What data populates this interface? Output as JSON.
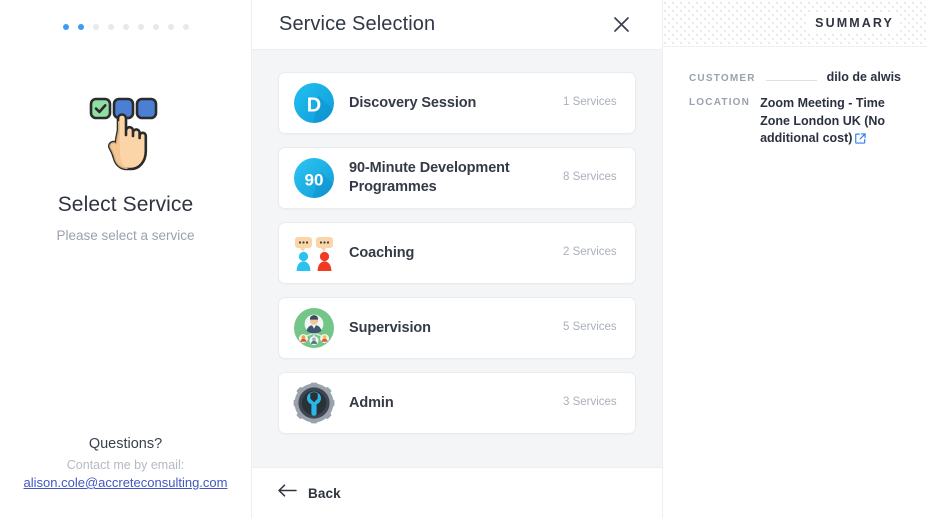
{
  "left": {
    "steps": {
      "total": 9,
      "active": 2
    },
    "hero_icon": "select-checkbox-hand-icon",
    "title": "Select Service",
    "subtitle": "Please select a service",
    "footer": {
      "questions": "Questions?",
      "contact_prompt": "Contact me by email:",
      "email": "alison.cole@accreteconsulting.com"
    }
  },
  "middle": {
    "header": {
      "title": "Service Selection",
      "close_icon": "close-icon"
    },
    "services": [
      {
        "icon": "letter-d-circle-icon",
        "name": "Discovery Session",
        "count": "1 Services"
      },
      {
        "icon": "number-90-circle-icon",
        "name": "90-Minute Development Programmes",
        "count": "8 Services"
      },
      {
        "icon": "two-people-chat-icon",
        "name": "Coaching",
        "count": "2 Services"
      },
      {
        "icon": "supervisor-network-icon",
        "name": "Supervision",
        "count": "5 Services"
      },
      {
        "icon": "gear-wrench-icon",
        "name": "Admin",
        "count": "3 Services"
      }
    ],
    "footer": {
      "back_label": "Back",
      "back_icon": "arrow-left-icon"
    }
  },
  "right": {
    "title": "SUMMARY",
    "rows": [
      {
        "label": "CUSTOMER",
        "value": "dilo de alwis",
        "leader": true,
        "link": false
      },
      {
        "label": "LOCATION",
        "value": "Zoom Meeting - Time Zone London UK (No additional cost)",
        "leader": false,
        "link": true
      }
    ]
  },
  "colors": {
    "accent_blue": "#3d9bf5",
    "link_blue": "#4157c4",
    "icon_cyan": "#16b0e8",
    "icon_green": "#74c588",
    "text_dark": "#2f3440",
    "text_muted": "#9aa1ae",
    "panel_bg": "#f4f5f7"
  }
}
